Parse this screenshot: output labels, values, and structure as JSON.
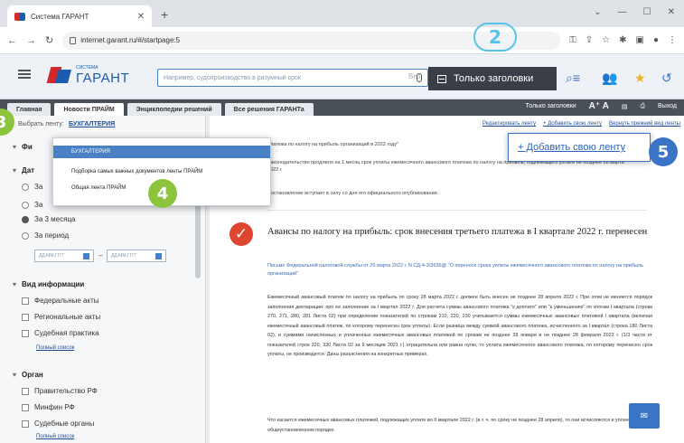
{
  "browser": {
    "tab_title": "Система ГАРАНТ",
    "url": "internet.garant.ru/#/startpage:5"
  },
  "header": {
    "logo_small": "СИСТЕМА",
    "logo_text": "ГАРАНТ",
    "search_placeholder": "Например, судопроизводство в разумный срок",
    "search_extra": "Вез",
    "titles_only_label": "Только заголовки"
  },
  "badges": {
    "b2": "2",
    "b3": "3",
    "b4": "4",
    "b5": "5"
  },
  "tabs": [
    {
      "label": "Главная"
    },
    {
      "label": "Новости ПРАЙМ"
    },
    {
      "label": "Энциклопедии решений"
    },
    {
      "label": "Все решения ГАРАНТа"
    }
  ],
  "tabs_right": {
    "titles_only": "Только заголовки",
    "font": "A⁺ A",
    "exit": "Выход"
  },
  "left": {
    "feed_label": "Выбрать ленту:",
    "feed_value": "БУХГАЛТЕРИЯ",
    "filters_title": "Фи",
    "date_title": "Дат",
    "date_opt1": "За",
    "date_opt2": "За",
    "date_opt3": "За 3 месяца",
    "date_opt4": "За период",
    "date_from": "ДД.ММ.ГГГГ",
    "date_to": "ДД.ММ.ГГГГ",
    "info_title": "Вид информации",
    "info_items": [
      "Федеральные акты",
      "Региональные акты",
      "Судебная практика"
    ],
    "full_list": "Полный список",
    "organ_title": "Орган",
    "organ_items": [
      "Правительство РФ",
      "Минфин РФ",
      "Судебные органы"
    ],
    "full_list2": "Полный список"
  },
  "dropdown": {
    "items": [
      "БУХГАЛТЕРИЯ",
      "Подборка самых важных документов ленты ПРАЙМ",
      "Общая лента ПРАЙМ"
    ]
  },
  "content": {
    "links": [
      "Редактировать ленту",
      "+ Добавить свою ленту",
      "Вернуть прежний вид ленты"
    ],
    "add_feed_label": "+ Добавить свою ленту",
    "prev_p1": "платежа по налогу на прибыль организаций в 2022 году\"",
    "prev_p2": "Законодательство продлило на 1 месяц срок уплаты ежемесячного авансового платежа по налогу на прибыль, подлежащего уплате не позднее 28 марта 2022 г.",
    "prev_p3": "Постановление вступает в силу со дня его официального опубликования.",
    "article_title": "Авансы по налогу на прибыль: срок внесения третьего платежа в I квартале 2022 г. перенесен",
    "article_sub": "Письмо Федеральной налоговой службы от 25 марта 2022 г. N СД-4-3/3636@ \"О переносе срока уплаты ежемесячного авансового платежа по налогу на прибыль организаций\"",
    "body": "Ежемесячный авансовый платеж по налогу на прибыль по сроку 28 марта 2022 г. должен быть внесен не позднее 28 апреля 2022 г. При этом не меняется порядок заполнения декларации: про ее заполнение за I квартал 2022 г. Для расчета суммы авансового платежа \"к доплате\" или \"к уменьшению\" по итогам I квартала (строки 270, 271, 280, 281 Листа 02) при определении показателей по строкам 210, 220, 230 учитываются суммы ежемесячных авансовых платежей I квартала (включая ежемесячный авансовый платеж, по которому перенесен срок уплаты). Если разница между суммой авансового платежа, исчисленного за I квартал (строка 180 Листа 02), и суммами начисленных и уплаченных ежемесячных авансовых платежей по срокам не позднее 28 января и не позднее 28 февраля 2022 г. (1/3 части от показателей строк 320, 330 Листа 02 за 9 месяцев 2021 г.) отрицательна или равна нулю, то уплата ежемесячного авансового платежа, по которому перенесен срок уплаты, не производится. Даны разъяснения на конкретных примерах.",
    "body2": "Что касается ежемесячных авансовых платежей, подлежащих уплате во II квартале 2022 г. (в т. ч. по сроку не позднее 28 апреля), то они исчисляются и уплачиваются в общеустановленном порядке."
  },
  "colors": {
    "accent_blue": "#3a74c4",
    "green_badge": "#8cc43e",
    "cyan_badge": "#58c3e8",
    "red_check": "#e0452f",
    "dark_bar": "#4a5058"
  }
}
